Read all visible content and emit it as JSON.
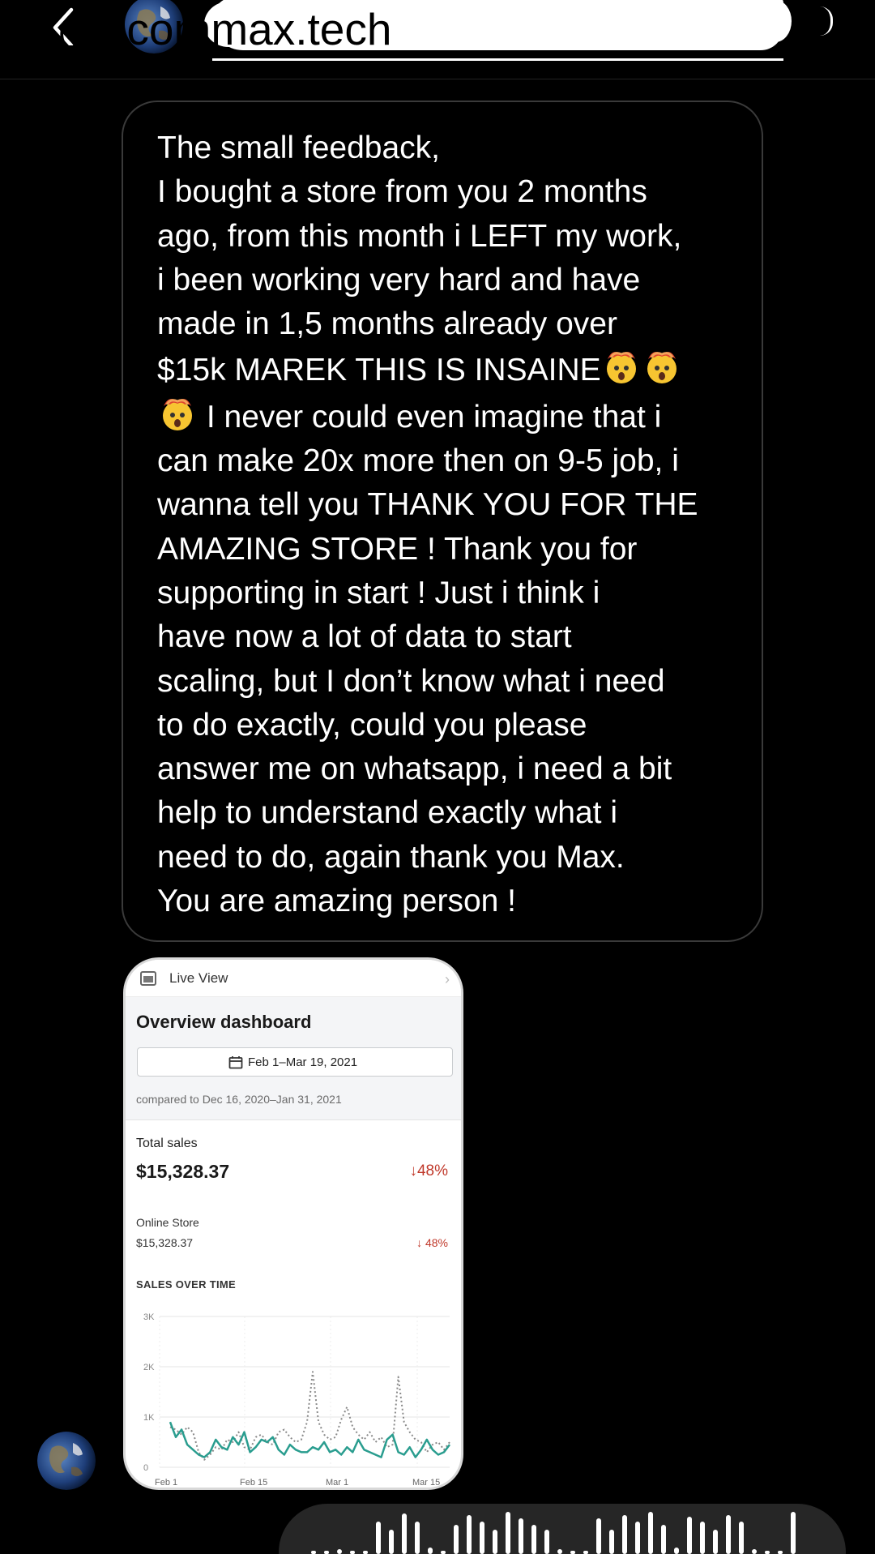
{
  "header": {
    "back_icon": "chevron-left-icon",
    "username": "@ecommax.tech"
  },
  "message": {
    "lines": [
      "The small feedback,",
      "I bought a store from you 2 months",
      "ago, from this month i LEFT my work,",
      "i been working very hard and have",
      "made in 1,5 months already over",
      "$15k MAREK THIS IS INSAINE",
      " I never could even imagine that i",
      "can make 20x more then on 9-5 job, i",
      "wanna tell you THANK YOU FOR THE",
      "AMAZING STORE ! Thank you for",
      "supporting in start ! Just i think i",
      "have now a lot of data to start",
      "scaling, but I don’t know what i need",
      "to do exactly, could you please",
      "answer me on whatsapp, i need a bit",
      "help to understand exactly what i",
      "need to do, again thank you Max.",
      "You are amazing person !"
    ],
    "emoji": "exploding-head-emoji"
  },
  "card": {
    "live_view": "Live View",
    "title": "Overview dashboard",
    "date_range": "Feb 1–Mar 19, 2021",
    "compared": "compared to Dec 16, 2020–Jan 31, 2021",
    "total_sales_label": "Total sales",
    "total_sales_value": "$15,328.37",
    "total_sales_pct": "↓48%",
    "online_store_label": "Online Store",
    "online_store_value": "$15,328.37",
    "online_store_pct": "↓ 48%",
    "sales_over_time": "SALES OVER TIME",
    "colors": {
      "current": "#2a9d8f",
      "previous": "#8a8a8a",
      "negative": "#c0392b"
    }
  },
  "chart_data": {
    "type": "line",
    "title": "SALES OVER TIME",
    "xlabel": "",
    "ylabel": "",
    "x_ticks": [
      "Feb 1",
      "Feb 15",
      "Mar 1",
      "Mar 15"
    ],
    "y_ticks": [
      "0",
      "1K",
      "2K",
      "3K"
    ],
    "ylim": [
      0,
      3000
    ],
    "grid": true,
    "series": [
      {
        "style": "solid",
        "values": [
          900,
          600,
          750,
          450,
          350,
          250,
          200,
          300,
          550,
          400,
          350,
          600,
          450,
          700,
          300,
          400,
          550,
          500,
          600,
          350,
          250,
          450,
          350,
          300,
          300,
          400,
          350,
          500,
          300,
          350,
          250,
          400,
          300,
          550,
          350,
          300,
          250,
          200,
          550,
          650,
          300,
          250,
          400,
          200,
          350,
          550,
          350,
          250,
          300,
          450
        ]
      },
      {
        "style": "dotted",
        "values": [
          800,
          750,
          650,
          800,
          700,
          300,
          150,
          250,
          400,
          350,
          550,
          500,
          700,
          400,
          350,
          600,
          650,
          500,
          450,
          700,
          750,
          600,
          500,
          550,
          900,
          1900,
          900,
          650,
          550,
          600,
          950,
          1200,
          800,
          650,
          550,
          700,
          500,
          600,
          400,
          450,
          1800,
          900,
          700,
          550,
          500,
          300,
          450,
          500,
          350,
          500
        ]
      }
    ]
  },
  "voice": {
    "play_icon": "waveform-icon"
  }
}
